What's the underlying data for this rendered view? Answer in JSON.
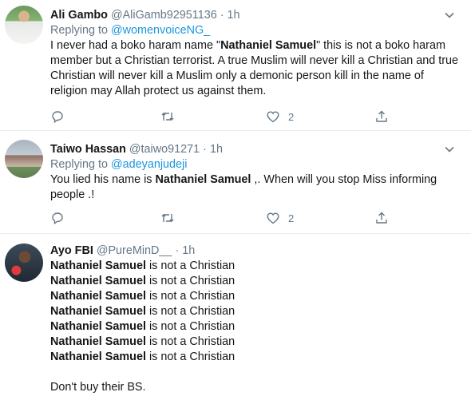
{
  "tweets": [
    {
      "name": "Ali Gambo",
      "handle": "@AliGamb92951136",
      "dot": "·",
      "time": "1h",
      "replying_prefix": "Replying to ",
      "replying_to": "@womenvoiceNG_",
      "body_before": "I never had a boko haram name \"",
      "body_bold": "Nathaniel Samuel",
      "body_after": "\" this is not a boko haram member but a Christian terrorist. A true Muslim will never kill a Christian and true Christian will never kill a Muslim only a demonic person kill in the name of religion may Allah protect us against  them.",
      "like_count": "2"
    },
    {
      "name": "Taiwo Hassan",
      "handle": "@taiwo91271",
      "dot": "·",
      "time": "1h",
      "replying_prefix": "Replying to ",
      "replying_to": "@adeyanjudeji",
      "body_before": "You lied his name is ",
      "body_bold": "Nathaniel Samuel",
      "body_after": " ,. When will you stop Miss informing people .!",
      "like_count": "2"
    },
    {
      "name": "Ayo FBI",
      "handle": "@PureMinD__",
      "dot": "·",
      "time": "1h",
      "lines": [
        {
          "bold": "Nathaniel Samuel",
          "rest": " is not a Christian"
        },
        {
          "bold": "Nathaniel Samuel",
          "rest": " is not a Christian"
        },
        {
          "bold": "Nathaniel Samuel",
          "rest": " is not a Christian"
        },
        {
          "bold": "Nathaniel Samuel",
          "rest": " is not a Christian"
        },
        {
          "bold": "Nathaniel Samuel",
          "rest": " is not a Christian"
        },
        {
          "bold": "Nathaniel Samuel",
          "rest": " is not a Christian"
        },
        {
          "bold": "Nathaniel Samuel",
          "rest": " is not a Christian"
        }
      ],
      "closing": "Don't buy their BS."
    }
  ],
  "icons": {
    "reply": "reply-icon",
    "retweet": "retweet-icon",
    "like": "heart-icon",
    "share": "share-icon",
    "more": "chevron-down-icon"
  },
  "colors": {
    "link": "#1b95e0",
    "muted": "#657786",
    "text": "#14171a",
    "divider": "#e6ecf0"
  }
}
